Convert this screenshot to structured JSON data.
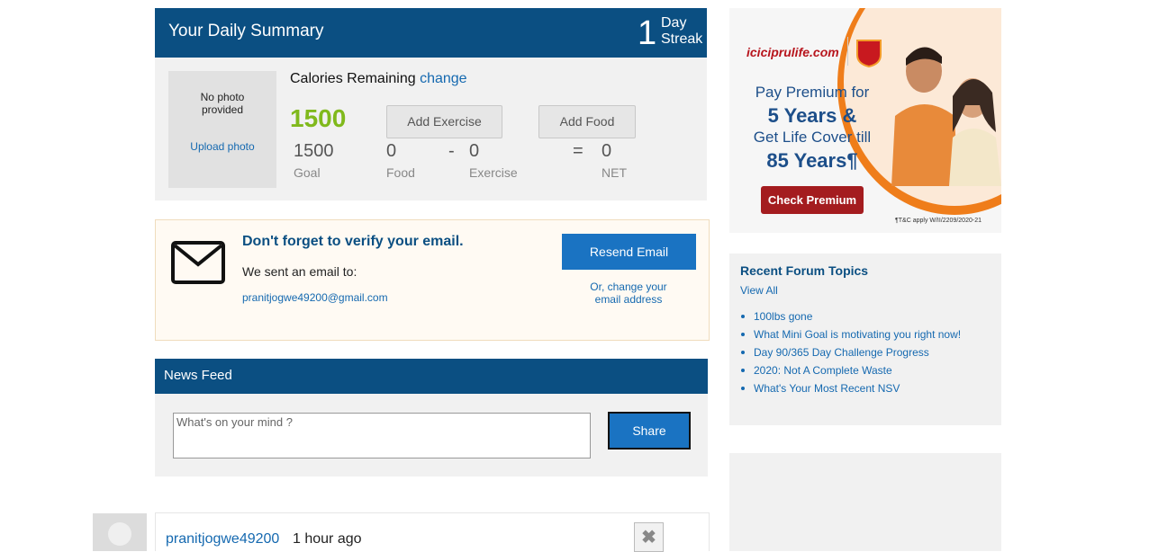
{
  "summary": {
    "title": "Your Daily Summary",
    "streak_number": "1",
    "streak_label_1": "Day",
    "streak_label_2": "Streak",
    "photo": {
      "no_photo_1": "No photo",
      "no_photo_2": "provided",
      "upload_label": "Upload photo"
    },
    "calories_title": "Calories Remaining",
    "change_label": "change",
    "remaining": "1500",
    "add_exercise_label": "Add Exercise",
    "add_food_label": "Add Food",
    "goal": {
      "value": "1500",
      "label": "Goal"
    },
    "food": {
      "value": "0",
      "label": "Food"
    },
    "minus": "-",
    "exercise": {
      "value": "0",
      "label": "Exercise"
    },
    "equals": "=",
    "net": {
      "value": "0",
      "label": "NET"
    }
  },
  "verify": {
    "icon": "envelope-icon",
    "title": "Don't forget to verify your email.",
    "sent_text": "We sent an email to:",
    "email": "pranitjogwe49200@gmail.com",
    "resend_label": "Resend Email",
    "change_line_1": "Or, change your",
    "change_line_2": "email address"
  },
  "news_feed": {
    "title": "News Feed",
    "input_placeholder": "What's on your mind ?",
    "share_label": "Share",
    "item": {
      "user": "pranitjogwe49200",
      "time": "1 hour ago",
      "close_icon": "✖"
    }
  },
  "ad": {
    "brand": "iciciprulife.com",
    "line1": "Pay Premium for",
    "line2": "5 Years &",
    "line3": "Get Life Cover till",
    "line4": "85 Years¶",
    "cta_label": "Check Premium",
    "tc": "¶T&C apply W/II/2209/2020-21",
    "accent_color": "#ef7d1a",
    "cta_color": "#a41c1f"
  },
  "forum": {
    "title": "Recent Forum Topics",
    "view_all": "View All",
    "topics": [
      "100lbs gone",
      "What Mini Goal is motivating you right now!",
      "Day 90/365 Day Challenge Progress",
      "2020: Not A Complete Waste",
      "What's Your Most Recent NSV"
    ]
  },
  "colors": {
    "header_blue": "#0b4f82",
    "link_blue": "#1569b0",
    "button_blue": "#1a73c2",
    "remaining_green": "#80b91c"
  }
}
